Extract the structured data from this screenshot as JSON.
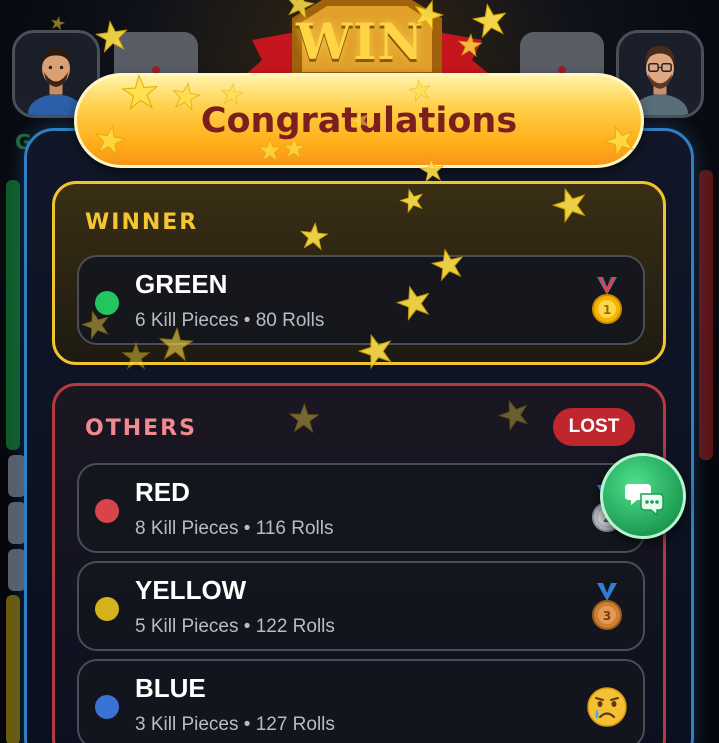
{
  "banner": {
    "win_text": "WIN",
    "title": "Congratulations"
  },
  "winner_section": {
    "label": "WINNER",
    "player": {
      "name": "GREEN",
      "stats": "6 Kill Pieces • 80 Rolls",
      "color": "#22c55e",
      "medal": "gold-medal-icon"
    }
  },
  "others_section": {
    "label": "OTHERS",
    "badge": "LOST",
    "players": [
      {
        "name": "RED",
        "stats": "8 Kill Pieces • 116 Rolls",
        "color": "#d9444a",
        "medal": "silver-medal-icon"
      },
      {
        "name": "YELLOW",
        "stats": "5 Kill Pieces • 122 Rolls",
        "color": "#d4b21c",
        "medal": "bronze-medal-icon"
      },
      {
        "name": "BLUE",
        "stats": "3 Kill Pieces • 127 Rolls",
        "color": "#3a73d6",
        "medal": "crying-face-icon"
      }
    ]
  },
  "background": {
    "side_text": "Gr"
  },
  "colors": {
    "winner_border": "#f0c430",
    "others_border": "#b43a3f",
    "panel_border": "#2f7fc2",
    "lost_badge": "#c0262d",
    "chat_button": "#1f9d55"
  }
}
